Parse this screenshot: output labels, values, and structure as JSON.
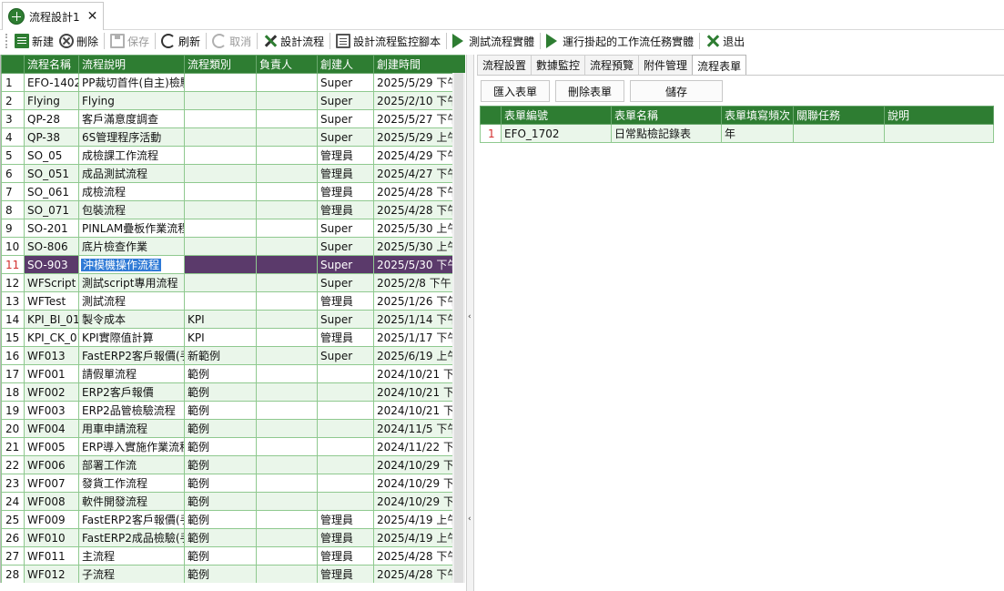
{
  "doc_tab": {
    "title": "流程設計1",
    "close": "✕"
  },
  "toolbar": {
    "new": "新建",
    "delete": "刪除",
    "save": "保存",
    "refresh": "刷新",
    "cancel": "取消",
    "design_flow": "設計流程",
    "design_monitor_script": "設計流程監控腳本",
    "test_instance": "測試流程實體",
    "run_pending_task": "運行掛起的工作流任務實體",
    "exit": "退出"
  },
  "left_grid": {
    "columns": [
      "流程名稱",
      "流程說明",
      "流程類別",
      "負責人",
      "創建人",
      "創建時間"
    ],
    "selected_row": 11,
    "rows": [
      {
        "no": "1",
        "name": "EFO-1402",
        "desc": "PP裁切首件(自主)檢驗",
        "cat": "",
        "owner": "",
        "creator": "Super",
        "time": "2025/5/29 下午 0"
      },
      {
        "no": "2",
        "name": "Flying",
        "desc": "Flying",
        "cat": "",
        "owner": "",
        "creator": "Super",
        "time": "2025/2/10 下午 0"
      },
      {
        "no": "3",
        "name": "QP-28",
        "desc": "客戶滿意度調查",
        "cat": "",
        "owner": "",
        "creator": "Super",
        "time": "2025/5/27 下午 0"
      },
      {
        "no": "4",
        "name": "QP-38",
        "desc": "6S管理程序活動",
        "cat": "",
        "owner": "",
        "creator": "Super",
        "time": "2025/5/29 上午 1"
      },
      {
        "no": "5",
        "name": "SO_05",
        "desc": "成檢課工作流程",
        "cat": "",
        "owner": "",
        "creator": "管理員",
        "time": "2025/4/29 下午 0"
      },
      {
        "no": "6",
        "name": "SO_051",
        "desc": "成品測試流程",
        "cat": "",
        "owner": "",
        "creator": "管理員",
        "time": "2025/4/27 下午 0"
      },
      {
        "no": "7",
        "name": "SO_061",
        "desc": "成檢流程",
        "cat": "",
        "owner": "",
        "creator": "管理員",
        "time": "2025/4/28 下午 0"
      },
      {
        "no": "8",
        "name": "SO_071",
        "desc": "包裝流程",
        "cat": "",
        "owner": "",
        "creator": "管理員",
        "time": "2025/4/28 下午 0"
      },
      {
        "no": "9",
        "name": "SO-201",
        "desc": "PINLAM疊板作業流程",
        "cat": "",
        "owner": "",
        "creator": "Super",
        "time": "2025/5/30 上午 0"
      },
      {
        "no": "10",
        "name": "SO-806",
        "desc": "底片檢查作業",
        "cat": "",
        "owner": "",
        "creator": "Super",
        "time": "2025/5/30 上午 1"
      },
      {
        "no": "11",
        "name": "SO-903",
        "desc": "沖模機操作流程",
        "cat": "",
        "owner": "",
        "creator": "Super",
        "time": "2025/5/30 下午 1"
      },
      {
        "no": "12",
        "name": "WFScript",
        "desc": "測試script專用流程",
        "cat": "",
        "owner": "",
        "creator": "Super",
        "time": "2025/2/8 下午 12"
      },
      {
        "no": "13",
        "name": "WFTest",
        "desc": "測試流程",
        "cat": "",
        "owner": "",
        "creator": "管理員",
        "time": "2025/1/26 下午 0"
      },
      {
        "no": "14",
        "name": "KPI_BI_01",
        "desc": "製令成本",
        "cat": "KPI",
        "owner": "",
        "creator": "Super",
        "time": "2025/1/14 下午 0"
      },
      {
        "no": "15",
        "name": "KPI_CK_01",
        "desc": "KPI實際值計算",
        "cat": "KPI",
        "owner": "",
        "creator": "管理員",
        "time": "2025/1/17 下午 0"
      },
      {
        "no": "16",
        "name": "WF013",
        "desc": "FastERP2客戶報價(手",
        "cat": "新範例",
        "owner": "",
        "creator": "Super",
        "time": "2025/6/19 上午 1"
      },
      {
        "no": "17",
        "name": "WF001",
        "desc": "請假單流程",
        "cat": "範例",
        "owner": "",
        "creator": "",
        "time": "2024/10/21 下午"
      },
      {
        "no": "18",
        "name": "WF002",
        "desc": "ERP2客戶報價",
        "cat": "範例",
        "owner": "",
        "creator": "",
        "time": "2024/10/21 下午"
      },
      {
        "no": "19",
        "name": "WF003",
        "desc": "ERP2品管檢驗流程",
        "cat": "範例",
        "owner": "",
        "creator": "",
        "time": "2024/10/21 下午"
      },
      {
        "no": "20",
        "name": "WF004",
        "desc": "用車申請流程",
        "cat": "範例",
        "owner": "",
        "creator": "",
        "time": "2024/11/5 下午 0"
      },
      {
        "no": "21",
        "name": "WF005",
        "desc": "ERP導入實施作業流程",
        "cat": "範例",
        "owner": "",
        "creator": "",
        "time": "2024/11/22 下午"
      },
      {
        "no": "22",
        "name": "WF006",
        "desc": "部署工作流",
        "cat": "範例",
        "owner": "",
        "creator": "",
        "time": "2024/10/29 下午"
      },
      {
        "no": "23",
        "name": "WF007",
        "desc": "發貨工作流程",
        "cat": "範例",
        "owner": "",
        "creator": "",
        "time": "2024/10/29 下午"
      },
      {
        "no": "24",
        "name": "WF008",
        "desc": "軟件開發流程",
        "cat": "範例",
        "owner": "",
        "creator": "",
        "time": "2024/10/29 下午"
      },
      {
        "no": "25",
        "name": "WF009",
        "desc": "FastERP2客戶報價(手",
        "cat": "範例",
        "owner": "",
        "creator": "管理員",
        "time": "2025/4/19 上午 0"
      },
      {
        "no": "26",
        "name": "WF010",
        "desc": "FastERP2成品檢驗(手",
        "cat": "範例",
        "owner": "",
        "creator": "管理員",
        "time": "2025/4/19 上午 1"
      },
      {
        "no": "27",
        "name": "WF011",
        "desc": "主流程",
        "cat": "範例",
        "owner": "",
        "creator": "管理員",
        "time": "2025/4/28 下午 0"
      },
      {
        "no": "28",
        "name": "WF012",
        "desc": "子流程",
        "cat": "範例",
        "owner": "",
        "creator": "管理員",
        "time": "2025/4/28 下午 0"
      }
    ]
  },
  "right_tabs": [
    "流程設置",
    "數據監控",
    "流程預覽",
    "附件管理",
    "流程表單"
  ],
  "right_active_tab": "流程表單",
  "right_actions": {
    "import": "匯入表單",
    "delete": "刪除表單",
    "save": "儲存"
  },
  "right_grid": {
    "columns": [
      "表單編號",
      "表單名稱",
      "表單填寫頻次",
      "關聯任務",
      "說明"
    ],
    "rows": [
      {
        "no": "1",
        "form_no": "EFO_1702",
        "form_name": "日常點檢記錄表",
        "freq": "年",
        "task": "",
        "note": ""
      }
    ]
  },
  "colors": {
    "header_green": "#2e7d32",
    "row_alt": "#eaf6ea",
    "selected_row": "#5b3a6b",
    "selected_edit": "#2f7ad6"
  }
}
